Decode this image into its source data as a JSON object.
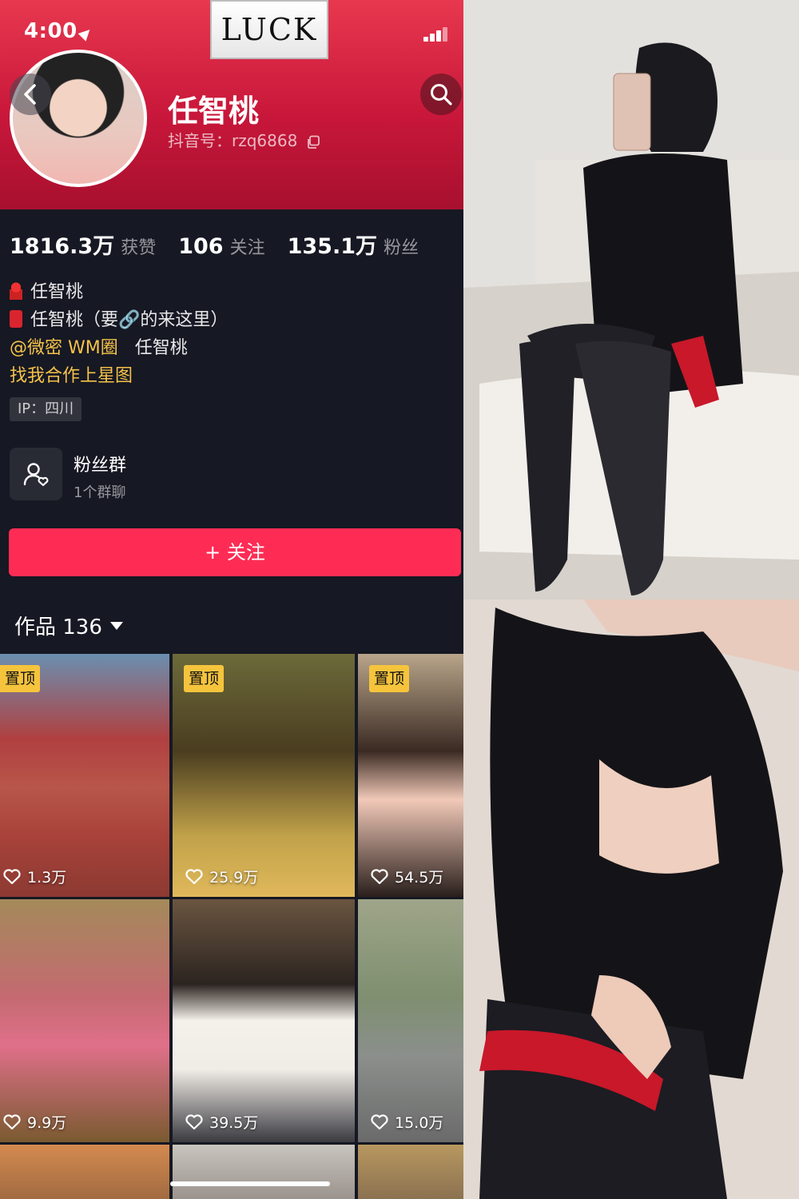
{
  "status_bar": {
    "time": "4:00"
  },
  "watermark": {
    "text": "LUCK"
  },
  "profile": {
    "name": "任智桃",
    "douyin_id": "抖音号：rzq6868"
  },
  "stats": [
    {
      "value": "1816.3万",
      "label": "获赞"
    },
    {
      "value": "106",
      "label": "关注"
    },
    {
      "value": "135.1万",
      "label": "粉丝"
    }
  ],
  "bio": {
    "line1": "任智桃",
    "line2": "任智桃（要🔗的来这里）",
    "line3_link": "@微密 WM圈",
    "line3_text": "任智桃",
    "line4": "找我合作上星图"
  },
  "ip_tag": "IP：四川",
  "fan_group": {
    "title": "粉丝群",
    "subtitle": "1个群聊"
  },
  "follow_button": "+ 关注",
  "works": {
    "label": "作品 136"
  },
  "videos": [
    {
      "pinned": "置顶",
      "likes": "1.3万"
    },
    {
      "pinned": "置顶",
      "likes": "25.9万"
    },
    {
      "pinned": "置顶",
      "likes": "54.5万"
    },
    {
      "likes": "9.9万"
    },
    {
      "likes": "39.5万"
    },
    {
      "likes": "15.0万"
    }
  ],
  "colors": {
    "accent": "#fe2c55",
    "header": "#c8173a",
    "pin": "#f5c43c",
    "background": "#161823"
  },
  "icons": [
    "back-icon",
    "search-icon",
    "copy-icon",
    "fan-group-icon",
    "heart-icon",
    "caret-down-icon"
  ]
}
